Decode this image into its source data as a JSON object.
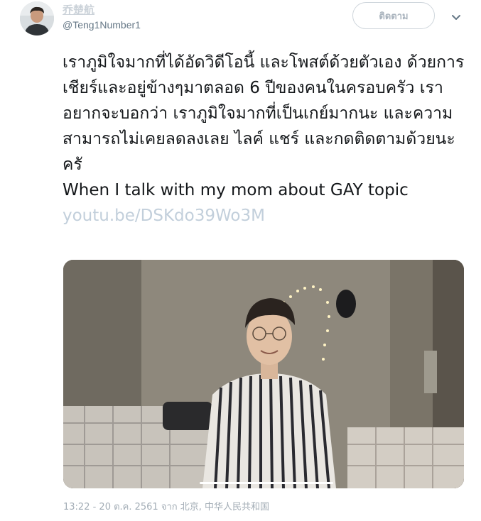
{
  "author": {
    "display_name": "乔楚航",
    "handle": "@Teng1Number1"
  },
  "follow_button": {
    "label": "ติดตาม"
  },
  "tweet": {
    "text": "เราภูมิใจมากที่ได้อัดวิดีโอนี้ และโพสต์ด้วยตัวเอง ด้วยการเชียร์และอยู่ข้างๆมาตลอด 6 ปีของคนในครอบครัว เราอยากจะบอกว่า เราภูมิใจมากที่เป็นเกย์มากนะ และความสามารถไม่เคยลดลงเลย ไลค์ แชร์ และกดติดตามด้วยนะครั\nWhen I talk with my mom about GAY topic ",
    "link": "youtu.be/DSKdo39Wo3M"
  },
  "meta": {
    "time": "13:22 - 20 ต.ค. 2561 จาก ",
    "location": "北京, 中华人民共和国"
  },
  "colors": {
    "link": "#c2cfdb",
    "muted": "#657786",
    "text": "#14171a"
  },
  "icons": {
    "more": "chevron-down-icon"
  }
}
